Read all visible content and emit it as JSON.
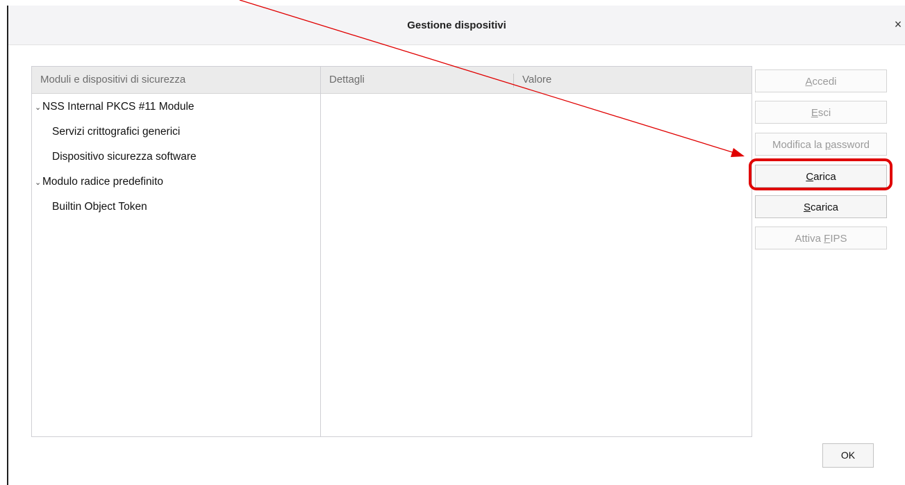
{
  "dialog": {
    "title": "Gestione dispositivi",
    "close_glyph": "×"
  },
  "tree": {
    "header": "Moduli e dispositivi di sicurezza",
    "items": [
      {
        "label": "NSS Internal PKCS #11 Module",
        "level": 0,
        "expanded": true
      },
      {
        "label": "Servizi crittografici generici",
        "level": 1
      },
      {
        "label": "Dispositivo sicurezza software",
        "level": 1
      },
      {
        "label": "Modulo radice predefinito",
        "level": 0,
        "expanded": true
      },
      {
        "label": "Builtin Object Token",
        "level": 1
      }
    ]
  },
  "details": {
    "col_details": "Dettagli",
    "col_value": "Valore"
  },
  "buttons": {
    "login": {
      "pre": "",
      "accel": "A",
      "post": "ccedi",
      "enabled": false
    },
    "logout": {
      "pre": "",
      "accel": "E",
      "post": "sci",
      "enabled": false
    },
    "change_password": {
      "pre": "Modifica la ",
      "accel": "p",
      "post": "assword",
      "enabled": false
    },
    "load": {
      "pre": "",
      "accel": "C",
      "post": "arica",
      "enabled": true
    },
    "unload": {
      "pre": "",
      "accel": "S",
      "post": "carica",
      "enabled": true
    },
    "enable_fips": {
      "pre": "Attiva ",
      "accel": "F",
      "post": "IPS",
      "enabled": false
    },
    "ok": "OK"
  },
  "colors": {
    "annotation": "#e00000"
  }
}
